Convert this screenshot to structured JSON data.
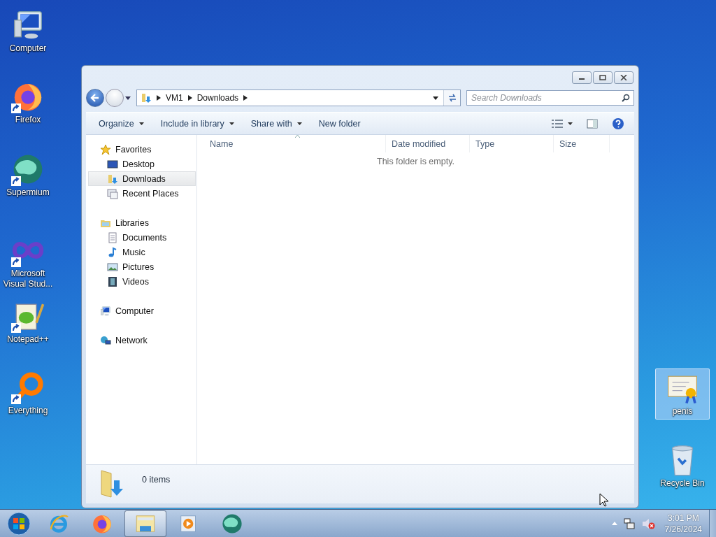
{
  "desktop_icons": [
    {
      "label": "Computer",
      "kind": "computer",
      "shortcut": false,
      "selected": false
    },
    {
      "label": "Firefox",
      "kind": "firefox",
      "shortcut": true,
      "selected": false
    },
    {
      "label": "Supermium",
      "kind": "supermium",
      "shortcut": true,
      "selected": false
    },
    {
      "label": "Microsoft Visual Stud...",
      "kind": "vstudio",
      "shortcut": true,
      "selected": false
    },
    {
      "label": "Notepad++",
      "kind": "notepad",
      "shortcut": true,
      "selected": false
    },
    {
      "label": "Everything",
      "kind": "everything",
      "shortcut": true,
      "selected": false
    },
    {
      "label": "penis",
      "kind": "certificate",
      "shortcut": false,
      "selected": true
    },
    {
      "label": "Recycle Bin",
      "kind": "recycle",
      "shortcut": false,
      "selected": false
    }
  ],
  "window": {
    "address": {
      "crumbs": [
        "VM1",
        "Downloads"
      ]
    },
    "search": {
      "placeholder": "Search Downloads"
    },
    "toolbar": [
      {
        "label": "Organize",
        "dropdown": true
      },
      {
        "label": "Include in library",
        "dropdown": true
      },
      {
        "label": "Share with",
        "dropdown": true
      },
      {
        "label": "New folder",
        "dropdown": false
      }
    ],
    "sidebar": [
      {
        "label": "Favorites",
        "kind": "star",
        "selected": false,
        "children": [
          {
            "label": "Desktop",
            "kind": "desktop",
            "selected": false
          },
          {
            "label": "Downloads",
            "kind": "downloads",
            "selected": true
          },
          {
            "label": "Recent Places",
            "kind": "recent",
            "selected": false
          }
        ]
      },
      {
        "label": "Libraries",
        "kind": "library",
        "selected": false,
        "children": [
          {
            "label": "Documents",
            "kind": "documents",
            "selected": false
          },
          {
            "label": "Music",
            "kind": "music",
            "selected": false
          },
          {
            "label": "Pictures",
            "kind": "pictures",
            "selected": false
          },
          {
            "label": "Videos",
            "kind": "videos",
            "selected": false
          }
        ]
      },
      {
        "label": "Computer",
        "kind": "computer",
        "selected": false
      },
      {
        "label": "Network",
        "kind": "network",
        "selected": false
      }
    ],
    "columns": [
      {
        "label": "Name",
        "sorted": true
      },
      {
        "label": "Date modified",
        "sorted": false
      },
      {
        "label": "Type",
        "sorted": false
      },
      {
        "label": "Size",
        "sorted": false
      }
    ],
    "empty_message": "This folder is empty.",
    "status": "0 items"
  },
  "taskbar": {
    "items": [
      {
        "kind": "ie",
        "selected": false
      },
      {
        "kind": "firefox",
        "selected": false
      },
      {
        "kind": "explorer",
        "selected": true
      },
      {
        "kind": "media",
        "selected": false
      },
      {
        "kind": "supermium",
        "selected": false
      }
    ],
    "clock": {
      "time": "3:01 PM",
      "date": "7/26/2024"
    },
    "volume_muted": true
  }
}
